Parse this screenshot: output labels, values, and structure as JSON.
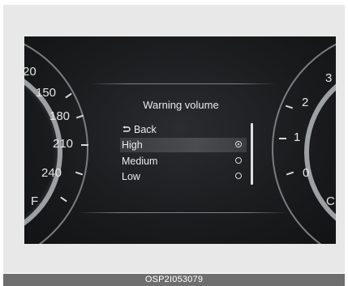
{
  "left_gauge": {
    "labels": [
      "20",
      "150",
      "180",
      "210",
      "240",
      "F"
    ]
  },
  "right_gauge": {
    "labels": [
      "3",
      "2",
      "1",
      "0",
      "C"
    ]
  },
  "menu": {
    "title": "Warning volume",
    "back_label": "Back",
    "items": [
      {
        "label": "High",
        "selected": true
      },
      {
        "label": "Medium",
        "selected": false
      },
      {
        "label": "Low",
        "selected": false
      }
    ]
  },
  "caption": "OSP2I053079",
  "colors": {
    "cluster_bg": "#1b1c1e",
    "text": "#ececec",
    "caption_bar": "#6e6e6e"
  },
  "icons": {
    "back": "back-arrow-icon",
    "radio_on": "radio-selected-icon",
    "radio_off": "radio-empty-icon"
  }
}
